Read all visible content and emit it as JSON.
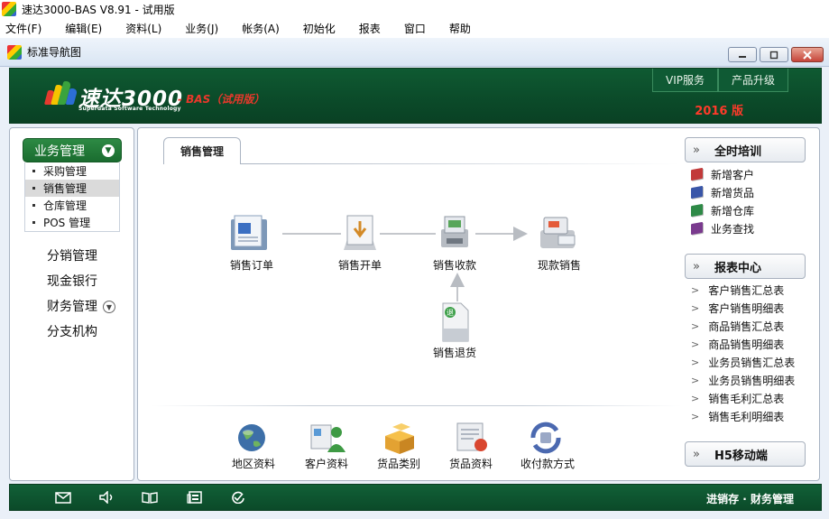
{
  "window": {
    "title": "速达3000-BAS V8.91 - 试用版"
  },
  "menu": [
    "文件(F)",
    "编辑(E)",
    "资料(L)",
    "业务(J)",
    "帐务(A)",
    "初始化",
    "报表",
    "窗口",
    "帮助"
  ],
  "inner_window": {
    "title": "标准导航图"
  },
  "banner": {
    "logo_title": "速达3000",
    "logo_sub": "Superdata Software Technology",
    "edition": "- BAS（试用版）",
    "vip_label": "VIP服务",
    "upgrade_label": "产品升级",
    "year": "2016 版"
  },
  "left": {
    "header": "业务管理",
    "sub_items": [
      "采购管理",
      "销售管理",
      "仓库管理",
      "POS 管理"
    ],
    "active_sub": 1,
    "nav": [
      "分销管理",
      "现金银行",
      "财务管理",
      "分支机构"
    ]
  },
  "center": {
    "tab": "销售管理",
    "flow": [
      "销售订单",
      "销售开单",
      "销售收款",
      "现款销售",
      "销售退货"
    ],
    "bottom": [
      "地区资料",
      "客户资料",
      "货品类别",
      "货品资料",
      "收付款方式"
    ]
  },
  "right": {
    "training_label": "全时培训",
    "training_links": [
      "新增客户",
      "新增货品",
      "新增仓库",
      "业务查找"
    ],
    "report_label": "报表中心",
    "report_links": [
      "客户销售汇总表",
      "客户销售明细表",
      "商品销售汇总表",
      "商品销售明细表",
      "业务员销售汇总表",
      "业务员销售明细表",
      "销售毛利汇总表",
      "销售毛利明细表"
    ],
    "mobile_label": "H5移动端"
  },
  "footer": {
    "text": "进销存 · 财务管理"
  },
  "colors": {
    "brand_green": "#0b4a29",
    "accent_red": "#e8382b"
  }
}
